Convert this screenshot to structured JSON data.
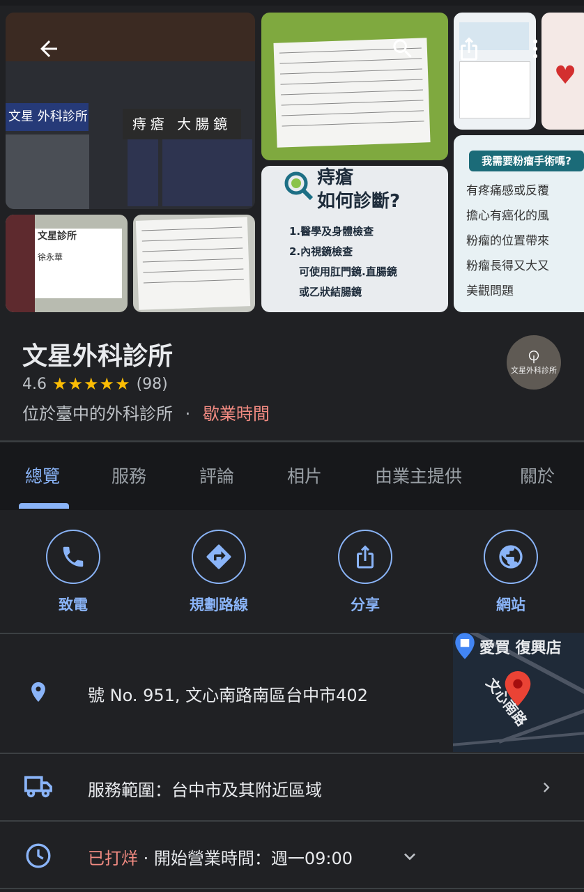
{
  "place": {
    "name": "文星外科診所",
    "rating": "4.6",
    "stars": "★★★★★",
    "review_count": "(98)",
    "category": "位於臺中的外科診所",
    "separator": "·",
    "hours_link": "歇業時間",
    "logo_text": "文星外科診所"
  },
  "photos": {
    "store_sign": "文星 外科診所",
    "store_sign2": "痔瘡 大腸鏡",
    "diag_title": "痔瘡\n如何診斷?",
    "diag_lines": [
      "1.醫學及身體檢查",
      "2.內視鏡檢查",
      "可使用肛門鏡.直腸鏡",
      "或乙狀結腸鏡"
    ],
    "poster_head": "我需要粉瘤手術嗎?",
    "poster_lines": [
      "有疼痛感或反覆",
      "擔心有癌化的風",
      "粉瘤的位置帶來",
      "粉瘤長得又大又",
      "美觀問題"
    ],
    "card_name": "文星診所",
    "card_person": "徐永華"
  },
  "tabs": [
    "總覽",
    "服務",
    "評論",
    "相片",
    "由業主提供",
    "關於"
  ],
  "actions": {
    "call": "致電",
    "directions": "規劃路線",
    "share": "分享",
    "website": "網站"
  },
  "address": "號 No. 951, 文心南路南區台中市402",
  "map": {
    "poi_label": "愛買 復興店",
    "road_label": "文心南路"
  },
  "service_area": "服務範圍：台中市及其附近區域",
  "hours": {
    "status": "已打烊",
    "separator": " · ",
    "detail": "開始營業時間：週一09:00"
  },
  "colors": {
    "accent": "#8ab4f8",
    "closed": "#f28b82",
    "star": "#fbbc04",
    "background": "#202124"
  }
}
